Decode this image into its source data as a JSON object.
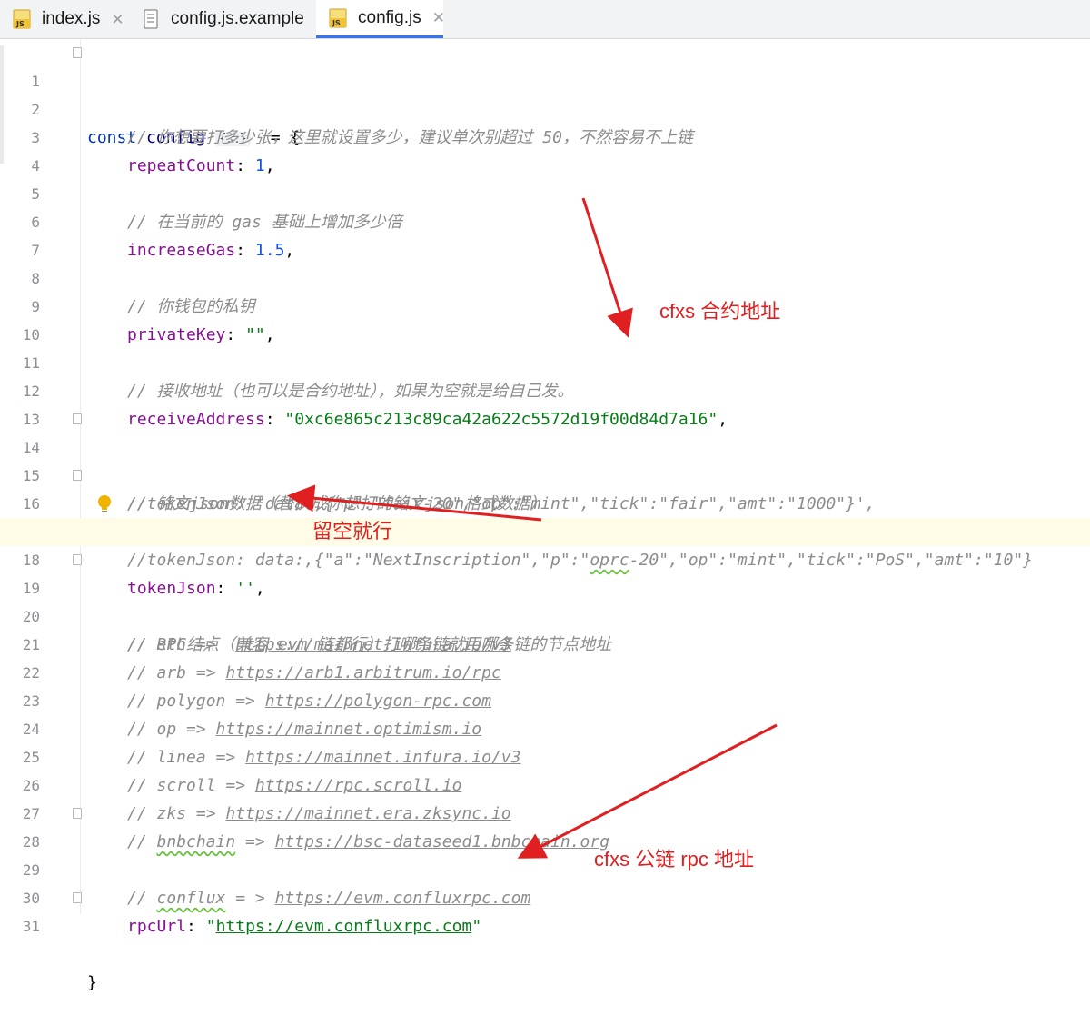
{
  "tabs": [
    {
      "label": "index.js",
      "icon": "js-file-icon",
      "active": false
    },
    {
      "label": "config.js.example",
      "icon": "text-file-icon",
      "active": false
    },
    {
      "label": "config.js",
      "icon": "js-file-icon",
      "active": true
    }
  ],
  "close_glyph": "✕",
  "editor": {
    "fold_placeholder": "{...}",
    "current_line": 18,
    "lines": [
      {
        "n": "1"
      },
      {
        "n": "2"
      },
      {
        "n": "3"
      },
      {
        "n": "4"
      },
      {
        "n": "5"
      },
      {
        "n": "6"
      },
      {
        "n": "7"
      },
      {
        "n": "8"
      },
      {
        "n": "9"
      },
      {
        "n": "10"
      },
      {
        "n": "11"
      },
      {
        "n": "12"
      },
      {
        "n": "13"
      },
      {
        "n": "14"
      },
      {
        "n": "15"
      },
      {
        "n": "16"
      },
      {
        "n": "17"
      },
      {
        "n": "18"
      },
      {
        "n": "19"
      },
      {
        "n": "20"
      },
      {
        "n": "21"
      },
      {
        "n": "22"
      },
      {
        "n": "23"
      },
      {
        "n": "24"
      },
      {
        "n": "25"
      },
      {
        "n": "26"
      },
      {
        "n": "27"
      },
      {
        "n": "28"
      },
      {
        "n": "29"
      },
      {
        "n": "30"
      },
      {
        "n": "31"
      }
    ],
    "code": {
      "l1_kw": "const",
      "l1_ident": "config",
      "l1_tail": "  = {",
      "l2": "// 你想要打多少张，这里就设置多少，建议单次别超过 50，不然容易不上链",
      "l3_prop": "repeatCount",
      "l3_val": "1",
      "l5": "// 在当前的 gas 基础上增加多少倍",
      "l6_prop": "increaseGas",
      "l6_val": "1.5",
      "l8": "// 你钱包的私钥",
      "l9_prop": "privateKey",
      "l9_val": "\"\"",
      "l11": "// 接收地址（也可以是合约地址），如果为空就是给自己发。",
      "l12_prop": "receiveAddress",
      "l12_val": "\"0xc6e865c213c89ca42a622c5572d19f00d84d7a16\"",
      "l14": "// 铭文json数据（替换成你想打的铭文json格式数据）",
      "l15": "//tokenJson: 'data:,{\"p\":\"fair-20\",\"op\":\"mint\",\"tick\":\"fair\",\"amt\":\"1000\"}',",
      "l16_a": "//tokenJson: data:,{\"a\":\"NextInscription\",\"p\":\"",
      "l16_b": "oprc",
      "l16_c": "-20\",\"op\":\"mint\",\"tick\":\"PoS\",\"amt\":\"10\"}",
      "l17_prop": "tokenJson",
      "l17_val": "''",
      "l19": "// RPC结点（兼容 evm 链都行）打哪条链就用哪条链的节点地址",
      "l20_a": "// eth =>  ",
      "l20_b": "https://mainnet.infura.io/v3",
      "l21_a": "// arb => ",
      "l21_b": "https://arb1.arbitrum.io/rpc",
      "l22_a": "// polygon => ",
      "l22_b": "https://polygon-rpc.com",
      "l23_a": "// op => ",
      "l23_b": "https://mainnet.optimism.io",
      "l24_a": "// linea => ",
      "l24_b": "https://mainnet.infura.io/v3",
      "l25_a": "// scroll => ",
      "l25_b": "https://rpc.scroll.io",
      "l26_a": "// zks => ",
      "l26_b": "https://mainnet.era.zksync.io",
      "l27_a": "// ",
      "l27_w": "bnbchain",
      "l27_m": " => ",
      "l27_b": "https://bsc-dataseed1.bnbchain.org",
      "l28_a": "// ",
      "l28_w": "conflux",
      "l28_m": " = > ",
      "l28_b": "https://evm.confluxrpc.com",
      "l30_prop": "rpcUrl",
      "l30_q1": "\"",
      "l30_link": "https://evm.confluxrpc.com",
      "l30_q2": "\"",
      "l31": "}"
    }
  },
  "annotations": {
    "contract": "cfxs 合约地址",
    "leave_empty": "留空就行",
    "rpc": "cfxs 公链 rpc 地址",
    "color": "#e02020"
  },
  "colors": {
    "keyword": "#0033b3",
    "property": "#871094",
    "number": "#1750eb",
    "string": "#067d17",
    "comment": "#8c8c8c",
    "tab_active_underline": "#3574f0",
    "current_line_bg": "#fefbe6"
  }
}
